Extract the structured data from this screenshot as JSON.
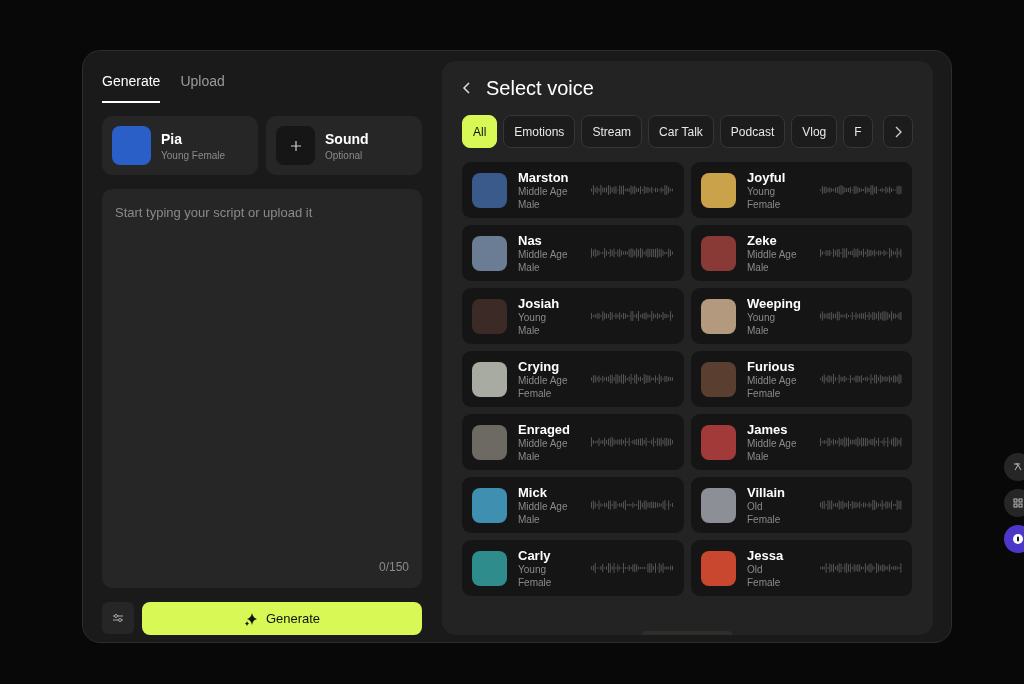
{
  "tabs": [
    {
      "label": "Generate",
      "selected": true
    },
    {
      "label": "Upload",
      "selected": false
    }
  ],
  "voice_card": {
    "name": "Pia",
    "description": "Young Female"
  },
  "sound_card": {
    "name": "Sound",
    "description": "Optional"
  },
  "script": {
    "placeholder": "Start typing your script or upload it",
    "counter": "0/150"
  },
  "generate_button": "Generate",
  "panel": {
    "title": "Select voice"
  },
  "filters": [
    {
      "label": "All",
      "selected": true
    },
    {
      "label": "Emotions",
      "selected": false
    },
    {
      "label": "Stream",
      "selected": false
    },
    {
      "label": "Car Talk",
      "selected": false
    },
    {
      "label": "Podcast",
      "selected": false
    },
    {
      "label": "Vlog",
      "selected": false
    },
    {
      "label": "F",
      "selected": false
    }
  ],
  "voices": [
    {
      "name": "Marston",
      "age": "Middle Age",
      "gender": "Male",
      "color": "#3a5a8c"
    },
    {
      "name": "Joyful",
      "age": "Young",
      "gender": "Female",
      "color": "#c9a24a"
    },
    {
      "name": "Nas",
      "age": "Middle Age",
      "gender": "Male",
      "color": "#6a7d94"
    },
    {
      "name": "Zeke",
      "age": "Middle Age",
      "gender": "Male",
      "color": "#8a3a36"
    },
    {
      "name": "Josiah",
      "age": "Young",
      "gender": "Male",
      "color": "#3b2a26"
    },
    {
      "name": "Weeping",
      "age": "Young",
      "gender": "Male",
      "color": "#b39a7e"
    },
    {
      "name": "Crying",
      "age": "Middle Age",
      "gender": "Female",
      "color": "#a8aba2"
    },
    {
      "name": "Furious",
      "age": "Middle Age",
      "gender": "Female",
      "color": "#5a3f30"
    },
    {
      "name": "Enraged",
      "age": "Middle Age",
      "gender": "Male",
      "color": "#6d6a63"
    },
    {
      "name": "James",
      "age": "Middle Age",
      "gender": "Male",
      "color": "#a33a3a"
    },
    {
      "name": "Mick",
      "age": "Middle Age",
      "gender": "Male",
      "color": "#3f8fb0"
    },
    {
      "name": "Villain",
      "age": "Old",
      "gender": "Female",
      "color": "#8c8f96"
    },
    {
      "name": "Carly",
      "age": "Young",
      "gender": "Female",
      "color": "#2f8c8c"
    },
    {
      "name": "Jessa",
      "age": "Old",
      "gender": "Female",
      "color": "#c9472f"
    }
  ]
}
